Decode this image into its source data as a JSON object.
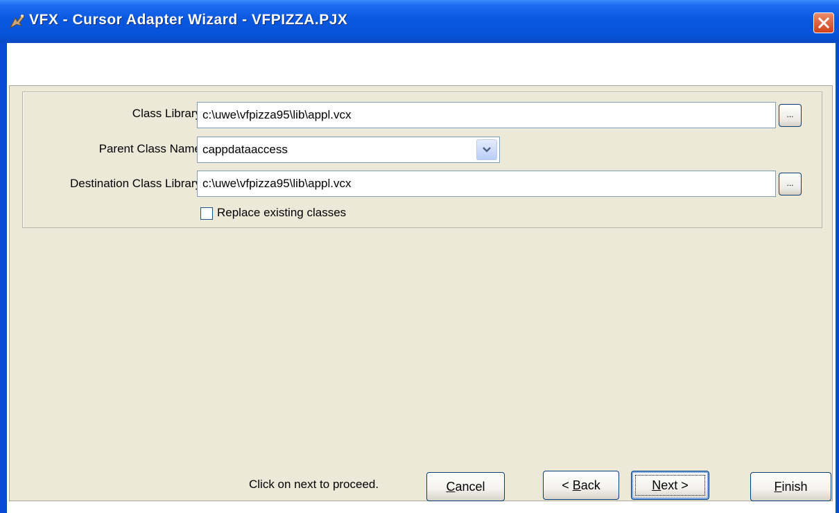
{
  "window": {
    "title": "VFX - Cursor Adapter Wizard - VFPIZZA.PJX",
    "app_icon": "vfx-app-icon",
    "close_icon": "close-icon"
  },
  "form": {
    "class_library": {
      "label": "Class Library",
      "value": "c:\\uwe\\vfpizza95\\lib\\appl.vcx",
      "browse_label": "..."
    },
    "parent_class": {
      "label": "Parent Class Name",
      "value": "cappdataaccess",
      "dropdown_icon": "chevron-down-icon"
    },
    "destination_library": {
      "label": "Destination Class Library",
      "value": "c:\\uwe\\vfpizza95\\lib\\appl.vcx",
      "browse_label": "..."
    },
    "replace_existing": {
      "label": "Replace existing classes",
      "checked": false
    }
  },
  "status": "Click on next to proceed.",
  "buttons": {
    "cancel": {
      "label": "Cancel",
      "accel": "C",
      "rest": "ancel"
    },
    "back": {
      "label": "< Back",
      "prefix": "< ",
      "accel": "B",
      "rest": "ack"
    },
    "next": {
      "label": "Next >",
      "accel": "N",
      "rest": "ext >"
    },
    "finish": {
      "label": "Finish",
      "accel": "F",
      "rest": "inish"
    }
  },
  "colors": {
    "titlebar": "#0654d8",
    "panel": "#ece9d8",
    "close_button": "#d2401a"
  }
}
